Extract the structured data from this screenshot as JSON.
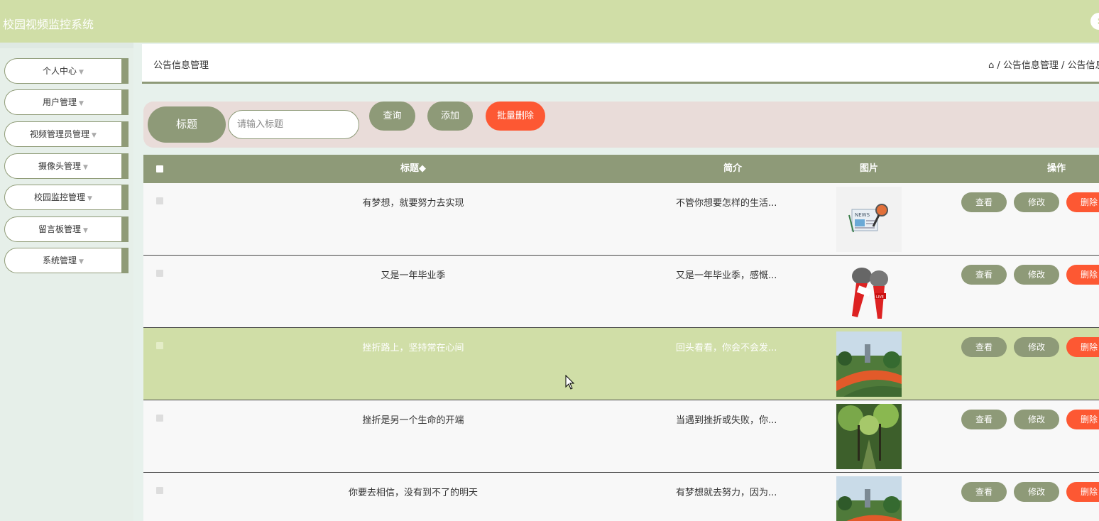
{
  "app": {
    "title": "校园视频监控系统"
  },
  "topbar": {
    "icon": "user-icon"
  },
  "sidebar": {
    "items": [
      {
        "label": "个人中心"
      },
      {
        "label": "用户管理"
      },
      {
        "label": "视频管理员管理"
      },
      {
        "label": "摄像头管理"
      },
      {
        "label": "校园监控管理"
      },
      {
        "label": "留言板管理"
      },
      {
        "label": "系统管理"
      }
    ]
  },
  "breadcrumb": {
    "page_title": "公告信息管理",
    "path": "/ 公告信息管理 / 公告信息",
    "home_icon": "home-icon"
  },
  "search": {
    "label": "标题",
    "placeholder": "请输入标题",
    "query_label": "查询",
    "add_label": "添加",
    "batch_delete_label": "批量删除"
  },
  "table": {
    "headers": {
      "title": "标题◆",
      "intro": "简介",
      "image": "图片",
      "actions": "操作"
    },
    "rows": [
      {
        "title": "有梦想，就要努力去实现",
        "intro": "不管你想要怎样的生活...",
        "image": "news-illustration",
        "highlight": false
      },
      {
        "title": "又是一年毕业季",
        "intro": "又是一年毕业季，感慨...",
        "image": "microphone-illustration",
        "highlight": false
      },
      {
        "title": "挫折路上，坚持常在心间",
        "intro": "回头看看，你会不会发...",
        "image": "campus-track-photo",
        "highlight": true
      },
      {
        "title": "挫折是另一个生命的开端",
        "intro": "当遇到挫折或失败，你...",
        "image": "tree-path-photo",
        "highlight": false
      },
      {
        "title": "你要去相信，没有到不了的明天",
        "intro": "有梦想就去努力，因为...",
        "image": "campus-track-photo",
        "highlight": false
      }
    ],
    "action_labels": {
      "view": "查看",
      "edit": "修改",
      "delete": "删除"
    }
  },
  "colors": {
    "accent": "#8e9a78",
    "header": "#d0dea7",
    "danger": "#fd5833",
    "search_bg": "#e9dcd9"
  }
}
